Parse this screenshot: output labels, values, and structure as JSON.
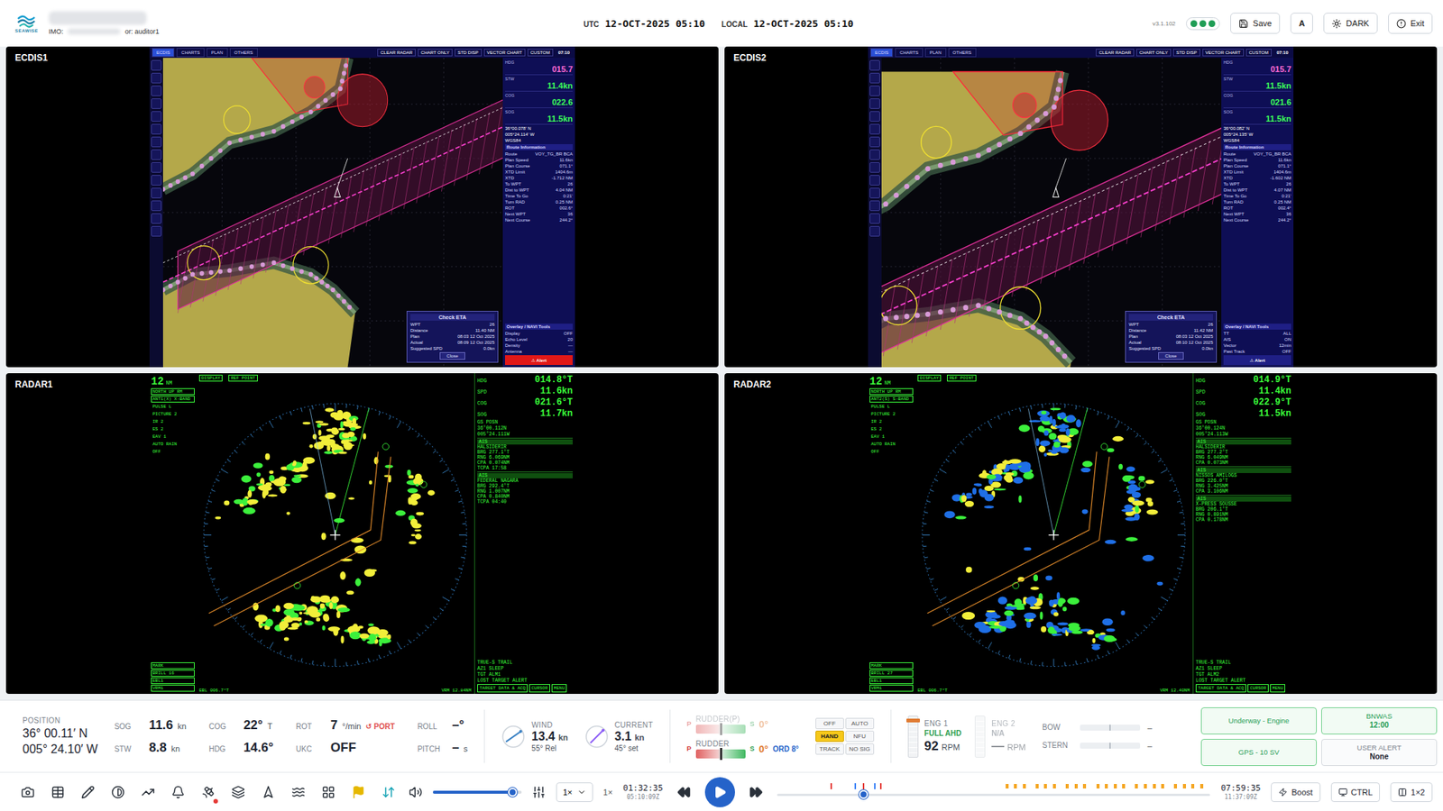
{
  "header": {
    "brand": "SEAWISE",
    "imo_label": "IMO:",
    "user": "or: auditor1",
    "utc_label": "UTC",
    "utc": "12-OCT-2025 05:10",
    "local_label": "LOCAL",
    "local": "12-OCT-2025 05:10",
    "version": "v3.1.102",
    "status_dots": [
      {
        "color": "#1f9d55"
      },
      {
        "color": "#1f9d55"
      },
      {
        "color": "#1f9d55"
      }
    ],
    "buttons": [
      {
        "label": "Save",
        "kind": "save"
      },
      {
        "label": "A",
        "kind": "plain"
      },
      {
        "label": "DARK",
        "kind": "theme"
      },
      {
        "label": "Exit",
        "kind": "exit"
      }
    ]
  },
  "ecdis": [
    {
      "title": "ECDIS1",
      "menu": [
        {
          "label": "ECDIS",
          "selected": true
        },
        {
          "label": "CHARTS",
          "selected": false
        },
        {
          "label": "PLAN",
          "selected": false
        },
        {
          "label": "OTHERS",
          "selected": false
        }
      ],
      "modes": [
        "CLEAR RADAR",
        "CHART ONLY",
        "STD DISP",
        "VECTOR CHART",
        "CUSTOM"
      ],
      "time": "07:10",
      "nav": [
        {
          "label": "HDG",
          "value": "015.7",
          "color": "#ff6ad5"
        },
        {
          "label": "STW",
          "value": "11.4kn",
          "color": "#3cff5a"
        },
        {
          "label": "COG",
          "value": "022.6",
          "color": "#3cff5a"
        },
        {
          "label": "SOG",
          "value": "11.5kn",
          "color": "#3cff5a"
        }
      ],
      "position": [
        "36°00.078' N",
        "005°24.114' W"
      ],
      "datum": "WGS84",
      "route_title": "Route Information",
      "route": [
        {
          "label": "Route",
          "value": "VOY_TG_BR BCA"
        },
        {
          "label": "Plan Speed",
          "value": "11.6kn"
        },
        {
          "label": "Plan Course",
          "value": "071.1°"
        },
        {
          "label": "XTD Limit",
          "value": "1404.6m"
        },
        {
          "label": "XTD",
          "value": "-1.712 NM"
        },
        {
          "label": "To WPT",
          "value": "26"
        },
        {
          "label": "Dist to WPT",
          "value": "4.04 NM"
        },
        {
          "label": "Time To Go",
          "value": "0:21'"
        },
        {
          "label": "Turn RAD",
          "value": "0.25 NM"
        },
        {
          "label": "ROT",
          "value": "002.6°"
        },
        {
          "label": "Next WPT",
          "value": "36"
        },
        {
          "label": "Next Course",
          "value": "244.2°"
        }
      ],
      "dialog": {
        "title": "Check ETA",
        "rows": [
          {
            "label": "WPT",
            "value": "26"
          },
          {
            "label": "Distance",
            "value": "11.40 NM"
          },
          {
            "label": "Plan",
            "value": "08:03 12 Oct 2025"
          },
          {
            "label": "Actual",
            "value": "08:09 12 Oct 2025"
          },
          {
            "label": "Suggested SPD",
            "value": "0.0kn"
          }
        ],
        "button": "Close"
      },
      "overlay": {
        "title": "Overlay / NAVI Tools",
        "rows": [
          {
            "label": "Display",
            "value": "OFF"
          },
          {
            "label": "Echo Level",
            "value": "20"
          },
          {
            "label": "Density",
            "value": "—"
          },
          {
            "label": "Antenna",
            "value": "—"
          }
        ]
      },
      "alert": {
        "text": "⚠ Alert",
        "on": true
      }
    },
    {
      "title": "ECDIS2",
      "menu": [
        {
          "label": "ECDIS",
          "selected": true
        },
        {
          "label": "CHARTS",
          "selected": false
        },
        {
          "label": "PLAN",
          "selected": false
        },
        {
          "label": "OTHERS",
          "selected": false
        }
      ],
      "modes": [
        "CLEAR RADAR",
        "CHART ONLY",
        "STD DISP",
        "VECTOR CHART",
        "CUSTOM"
      ],
      "time": "07:10",
      "nav": [
        {
          "label": "HDG",
          "value": "015.7",
          "color": "#ff6ad5"
        },
        {
          "label": "STW",
          "value": "11.5kn",
          "color": "#3cff5a"
        },
        {
          "label": "COG",
          "value": "021.6",
          "color": "#3cff5a"
        },
        {
          "label": "SOG",
          "value": "11.5kn",
          "color": "#3cff5a"
        }
      ],
      "position": [
        "36°00.082' N",
        "005°24.135' W"
      ],
      "datum": "WGS84",
      "route_title": "Route Information",
      "route": [
        {
          "label": "Route",
          "value": "VOY_TG_BR BCA"
        },
        {
          "label": "Plan Speed",
          "value": "11.6kn"
        },
        {
          "label": "Plan Course",
          "value": "071.1°"
        },
        {
          "label": "XTD Limit",
          "value": "1404.6m"
        },
        {
          "label": "XTD",
          "value": "-1.602 NM"
        },
        {
          "label": "To WPT",
          "value": "26"
        },
        {
          "label": "Dist to WPT",
          "value": "4.07 NM"
        },
        {
          "label": "Time To Go",
          "value": "0:21'"
        },
        {
          "label": "Turn RAD",
          "value": "0.25 NM"
        },
        {
          "label": "ROT",
          "value": "002.4°"
        },
        {
          "label": "Next WPT",
          "value": "36"
        },
        {
          "label": "Next Course",
          "value": "244.2°"
        }
      ],
      "dialog": {
        "title": "Check ETA",
        "rows": [
          {
            "label": "WPT",
            "value": "26"
          },
          {
            "label": "Distance",
            "value": "11.42 NM"
          },
          {
            "label": "Plan",
            "value": "08:03 12 Oct 2025"
          },
          {
            "label": "Actual",
            "value": "08:10 12 Oct 2025"
          },
          {
            "label": "Suggested SPD",
            "value": "0.0kn"
          }
        ],
        "button": "Close"
      },
      "overlay": {
        "title": "Overlay / NAVI Tools",
        "rows": [
          {
            "label": "TT",
            "value": "ALL"
          },
          {
            "label": "AIS",
            "value": "ON"
          },
          {
            "label": "Vector",
            "value": "12min"
          },
          {
            "label": "Past Track",
            "value": "OFF"
          }
        ]
      },
      "alert": {
        "text": "⚠ Alert",
        "on": false
      }
    }
  ],
  "radars": [
    {
      "title": "RADAR1",
      "range": "12",
      "range_unit": "NM",
      "top": [
        "DISPLAY",
        "REF POINT"
      ],
      "left": [
        "NORTH UP RM",
        "ANT1(X) X-BAND",
        "PULSE L",
        "PICTURE 2",
        "IR 2",
        "ES 2",
        "EAV 1",
        "AUTO RAIN",
        "OFF"
      ],
      "bottom_left": [
        "MARK",
        "BRILL 16",
        "EBL1",
        "VRM1"
      ],
      "bottom": [
        "EBL 006.7°T",
        "VRM 12.84NM"
      ],
      "own": [
        {
          "label": "HDG",
          "value": "014.8°T"
        },
        {
          "label": "SPD",
          "value": "11.6kn"
        },
        {
          "label": "COG",
          "value": "021.6°T"
        },
        {
          "label": "SOG",
          "value": "11.7kn"
        }
      ],
      "posn": [
        "GS POSN",
        "36°00.112N",
        "005°24.111W"
      ],
      "targets": [
        {
          "type": "AIS",
          "name": "HALSIDERIR",
          "rows": [
            "BRG 277.1°T",
            "RNG 6.069NM",
            "CPA 0.074NM",
            "TCPA 17:58"
          ]
        },
        {
          "type": "AIS",
          "name": "FEDERAL NAGARA",
          "rows": [
            "BRG 292.4°T",
            "RNG 1.007NM",
            "CPA 0.840NM",
            "TCPA 04:40"
          ]
        }
      ],
      "status": [
        "TRUE-S TRAIL",
        "AZ1 SLEEP",
        "TGT ALM1",
        "LOST TARGET ALERT"
      ],
      "footer": [
        "TARGET DATA & ACQ",
        "CURSOR",
        "MENU"
      ],
      "echo_colors": [
        "#f2ee3a",
        "#f2ee3a",
        "#3cf03c"
      ]
    },
    {
      "title": "RADAR2",
      "range": "12",
      "range_unit": "NM",
      "top": [
        "DISPLAY",
        "REF POINT"
      ],
      "left": [
        "NORTH UP RM",
        "ANT2(S) S-BAND",
        "PULSE L",
        "PICTURE 2",
        "IR 2",
        "ES 2",
        "EAV 1",
        "AUTO RAIN",
        "OFF"
      ],
      "bottom_left": [
        "MARK",
        "BRILL 27",
        "EBL1",
        "VRM1"
      ],
      "bottom": [
        "EBL 006.7°T",
        "VRM 12.40NM"
      ],
      "own": [
        {
          "label": "HDG",
          "value": "014.9°T"
        },
        {
          "label": "SPD",
          "value": "11.4kn"
        },
        {
          "label": "COG",
          "value": "022.9°T"
        },
        {
          "label": "SOG",
          "value": "11.5kn"
        }
      ],
      "posn": [
        "GS POSN",
        "36°00.124N",
        "005°24.113W"
      ],
      "targets": [
        {
          "type": "AIS",
          "name": "HALSIDERIR",
          "rows": [
            "BRG 277.2°T",
            "RNG 6.049NM",
            "CPA 0.073NM"
          ]
        },
        {
          "type": "AIS",
          "name": "NISSOS AMILOGS",
          "rows": [
            "BRG 226.0°T",
            "RNG 3.425NM",
            "CPA 3.106NM"
          ]
        },
        {
          "type": "AIS",
          "name": "X-PRESS SOUSSE",
          "rows": [
            "BRG 206.1°T",
            "RNG 0.891NM",
            "CPA 0.178NM"
          ]
        }
      ],
      "status": [
        "TRUE-S TRAIL",
        "AZ1 SLEEP",
        "TGT ALM2",
        "LOST TARGET ALERT"
      ],
      "footer": [
        "TARGET DATA & ACQ",
        "CURSOR",
        "MENU"
      ],
      "echo_colors": [
        "#f2ee3a",
        "#1f6fe6",
        "#1f6fe6",
        "#3cf03c"
      ]
    }
  ],
  "status_bar": {
    "position": {
      "label": "POSITION",
      "lat": "36° 00.11′ N",
      "lon": "005° 24.10′ W"
    },
    "nav": [
      {
        "label": "SOG",
        "value": "11.6",
        "unit": "kn",
        "note": ""
      },
      {
        "label": "COG",
        "value": "22°",
        "unit": "T",
        "note": ""
      },
      {
        "label": "ROT",
        "value": "7",
        "unit": "°/min",
        "note": "↺ PORT"
      },
      {
        "label": "ROLL",
        "value": "–°",
        "unit": "",
        "note": ""
      },
      {
        "label": "STW",
        "value": "8.8",
        "unit": "kn",
        "note": ""
      },
      {
        "label": "HDG",
        "value": "14.6°",
        "unit": "",
        "note": ""
      },
      {
        "label": "UKC",
        "value": "OFF",
        "unit": "",
        "note": ""
      },
      {
        "label": "PITCH",
        "value": "–",
        "unit": "s",
        "note": ""
      }
    ],
    "environment": [
      {
        "label": "WIND",
        "value": "13.4",
        "unit": "kn",
        "detail": "55° Rel",
        "angle": 55,
        "color": "#3b82c4"
      },
      {
        "label": "CURRENT",
        "value": "3.1",
        "unit": "kn",
        "detail": "45° set",
        "angle": 45,
        "color": "#8b5cf6"
      }
    ],
    "rudders": [
      {
        "label": "RUDDER(P)",
        "left": "P",
        "right": "S",
        "reading": "0°",
        "order": "",
        "level": 0.5,
        "enabled": false
      },
      {
        "label": "RUDDER",
        "left": "P",
        "right": "S",
        "reading": "0°",
        "order": "ORD 8°",
        "level": 0.5,
        "enabled": true
      }
    ],
    "steering_modes": [
      {
        "label": "OFF",
        "selected": false
      },
      {
        "label": "AUTO",
        "selected": false
      },
      {
        "label": "HAND",
        "selected": true
      },
      {
        "label": "NFU",
        "selected": false
      },
      {
        "label": "TRACK",
        "selected": false
      },
      {
        "label": "NO SIG",
        "selected": false
      }
    ],
    "engines": [
      {
        "label": "ENG 1",
        "order": "FULL AHD",
        "rpm": "92",
        "unit": "RPM",
        "level": 0.9,
        "enabled": true
      },
      {
        "label": "ENG 2",
        "order": "N/A",
        "rpm": "—",
        "unit": "RPM",
        "level": 0,
        "enabled": false
      }
    ],
    "thrusters": [
      {
        "label": "BOW",
        "reading": "–"
      },
      {
        "label": "STERN",
        "reading": "–"
      }
    ],
    "status": [
      {
        "title": "Underway - Engine",
        "value": "",
        "kind": "ok"
      },
      {
        "title": "BNWAS",
        "value": "12:00",
        "kind": "ok"
      },
      {
        "title": "GPS - 10 SV",
        "value": "",
        "kind": "ok"
      },
      {
        "title": "USER ALERT",
        "value": "None",
        "kind": "neutral"
      }
    ]
  },
  "playback": {
    "tools": [
      {
        "selected": false,
        "badge": false
      },
      {
        "selected": false,
        "badge": false
      },
      {
        "selected": false,
        "badge": false
      },
      {
        "selected": false,
        "badge": false
      },
      {
        "selected": false,
        "badge": false
      },
      {
        "selected": false,
        "badge": false
      },
      {
        "selected": false,
        "badge": true
      },
      {
        "selected": false,
        "badge": false
      },
      {
        "selected": false,
        "badge": false
      },
      {
        "selected": false,
        "badge": false
      },
      {
        "selected": false,
        "badge": false
      },
      {
        "selected": true,
        "badge": false
      }
    ],
    "sync": {
      "selected": true
    },
    "volume": {
      "level": 0.9
    },
    "speed_select": "1×",
    "speed": "1×",
    "current_time": "01:32:35",
    "current_utc": "05:10:09Z",
    "timeline": {
      "level": 0.2,
      "markers": [
        {
          "at": 0.125,
          "color": "#e53935"
        },
        {
          "at": 0.18,
          "color": "#3b82f6"
        },
        {
          "at": 0.2,
          "color": "#e53935"
        },
        {
          "at": 0.225,
          "color": "#3b82f6"
        },
        {
          "at": 0.24,
          "color": "#e53935"
        }
      ],
      "events": [
        0.53,
        0.55,
        0.57,
        0.6,
        0.62,
        0.64,
        0.67,
        0.69,
        0.71,
        0.74,
        0.76,
        0.78,
        0.8,
        0.83,
        0.85,
        0.87,
        0.89,
        0.92,
        0.94,
        0.96,
        0.98
      ]
    },
    "end_time": "07:59:35",
    "end_utc": "11:37:09Z",
    "buttons": [
      {
        "label": "Boost",
        "kind": "boost"
      },
      {
        "label": "CTRL",
        "kind": "ctrl"
      },
      {
        "label": "1×2",
        "kind": "layout"
      }
    ]
  }
}
